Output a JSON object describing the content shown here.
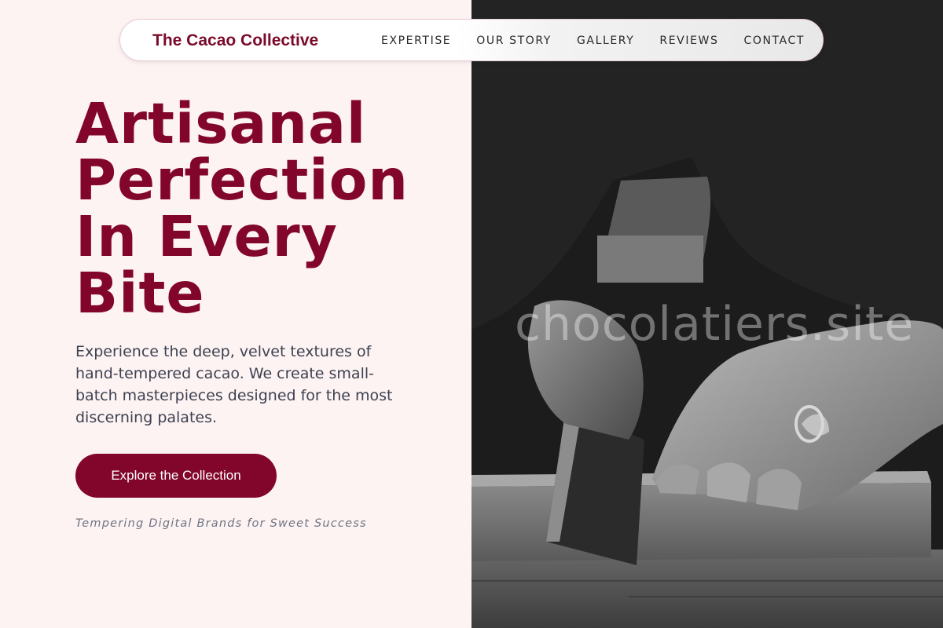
{
  "brand": {
    "name": "The Cacao Collective"
  },
  "nav": {
    "links": [
      "EXPERTISE",
      "OUR STORY",
      "GALLERY",
      "REVIEWS",
      "CONTACT"
    ]
  },
  "hero": {
    "title_lines": [
      "Artisanal",
      "Perfection",
      "In Every",
      "Bite"
    ],
    "description": "Experience the deep, velvet textures of hand-tempered cacao. We create small-batch masterpieces designed for the most discerning palates.",
    "cta_label": "Explore the Collection",
    "tagline": "Tempering Digital Brands for Sweet Success"
  },
  "image": {
    "watermark": "chocolatiers.site",
    "description": "Black and white photo of a craftsman's hands sawing a wooden block"
  },
  "colors": {
    "accent": "#82062b",
    "background": "#fdf3f3",
    "text": "#3d4150"
  }
}
